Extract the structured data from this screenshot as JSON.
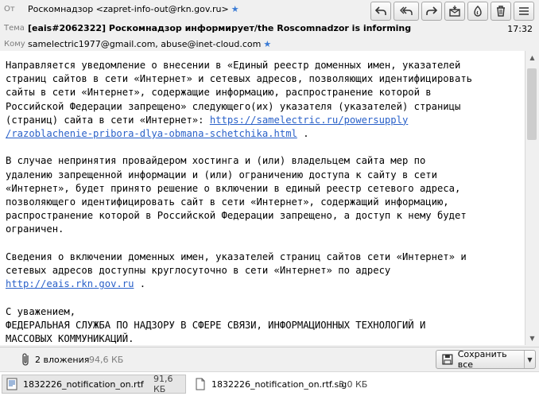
{
  "header": {
    "from_label": "От",
    "from_value": "Роскомнадзор <zapret-info-out@rkn.gov.ru>",
    "subject_label": "Тема",
    "subject_value": "[eais#2062322] Роскомнадзор информирует/the Roscomnadzor is informing",
    "to_label": "Кому",
    "to_value": "samelectric1977@gmail.com, abuse@inet-cloud.com",
    "time": "17:32"
  },
  "toolbar": {
    "buttons": [
      "reply-icon",
      "reply-all-icon",
      "forward-icon",
      "archive-icon",
      "junk-icon",
      "delete-icon",
      "more-icon"
    ]
  },
  "message": {
    "p1_before": "Направляется уведомление о внесении в «Единый реестр доменных имен, указателей\nстраниц сайтов в сети «Интернет» и сетевых адресов, позволяющих идентифицировать\nсайты в сети «Интернет», содержащие информацию, распространение которой в\nРоссийской Федерации запрещено» следующего(их) указателя (указателей) страницы\n(страниц) сайта в сети «Интернет»: ",
    "link1_line1": "https://samelectric.ru/powersupply",
    "link1_line2": "/razoblachenie-pribora-dlya-obmana-schetchika.html",
    "p1_after": " .",
    "p2": "В случае непринятия провайдером хостинга и (или) владельцем сайта мер по\nудалению запрещенной информации и (или) ограничению доступа к сайту в сети\n«Интернет», будет принято решение о включении в единый реестр сетевого адреса,\nпозволяющего идентифицировать сайт в сети «Интернет», содержащий информацию,\nраспространение которой в Российской Федерации запрещено, а доступ к нему будет\nограничен.",
    "p3_before": "Сведения о включении доменных имен, указателей страниц сайтов сети «Интернет» и\nсетевых адресов доступны круглосуточно в сети «Интернет» по адресу\n",
    "link2": "http://eais.rkn.gov.ru",
    "p3_after": " .",
    "p4": "С уважением,\nФЕДЕРАЛЬНАЯ СЛУЖБА ПО НАДЗОРУ В СФЕРЕ СВЯЗИ, ИНФОРМАЦИОННЫХ ТЕХНОЛОГИЙ И\nМАССОВЫХ КОММУНИКАЦИЙ."
  },
  "attachments": {
    "count_label": "2 вложения",
    "total_size": "94,6 КБ",
    "save_all_label": "Сохранить все",
    "files": [
      {
        "name": "1832226_notification_on.rtf",
        "size": "91,6 КБ"
      },
      {
        "name": "1832226_notification_on.rtf.sig",
        "size": "3,0 КБ"
      }
    ]
  },
  "colors": {
    "link": "#2a61c9",
    "star": "#3a7bd5"
  }
}
